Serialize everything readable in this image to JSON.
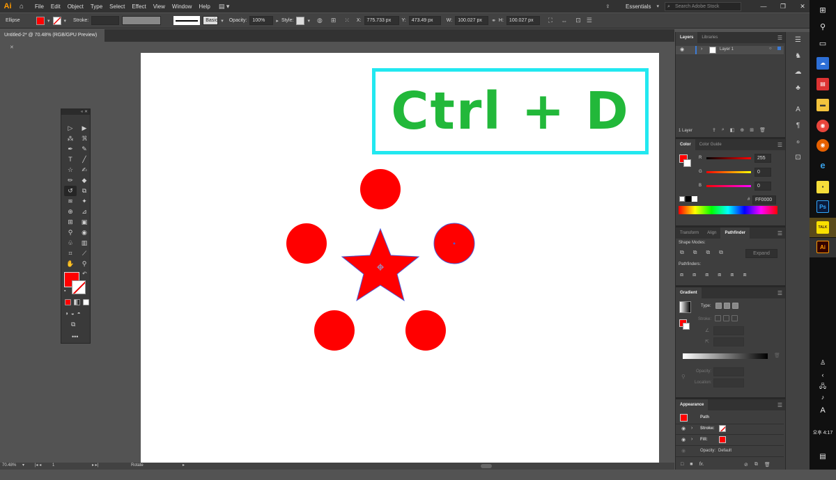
{
  "app": {
    "logo": "Ai"
  },
  "menu": [
    "File",
    "Edit",
    "Object",
    "Type",
    "Select",
    "Effect",
    "View",
    "Window",
    "Help"
  ],
  "workspace": "Essentials",
  "search_placeholder": "Search Adobe Stock",
  "control": {
    "object_type": "Ellipse",
    "stroke_label": "Stroke:",
    "brush": "Basic",
    "opacity_label": "Opacity:",
    "opacity": "100%",
    "style_label": "Style:",
    "x_label": "X:",
    "x": "775.733 px",
    "y_label": "Y:",
    "y": "473.49 px",
    "w_label": "W:",
    "w": "100.027 px",
    "h_label": "H:",
    "h": "100.027 px"
  },
  "document": {
    "tab": "Untitled-2* @ 70.48% (RGB/GPU Preview)"
  },
  "status": {
    "zoom": "70.48%",
    "artboard": "1",
    "tool": "Rotate"
  },
  "annotation": {
    "text": "Ctrl + D"
  },
  "layers": {
    "tab1": "Layers",
    "tab2": "Libraries",
    "layer_name": "Layer 1",
    "count": "1 Layer"
  },
  "color": {
    "tab1": "Color",
    "tab2": "Color Guide",
    "r_label": "R",
    "g_label": "G",
    "b_label": "B",
    "r": "255",
    "g": "0",
    "b": "0",
    "hex_label": "#",
    "hex": "FF0000",
    "fill": "#ff0000"
  },
  "pathfinder": {
    "tab1": "Transform",
    "tab2": "Align",
    "tab3": "Pathfinder",
    "shape_modes": "Shape Modes:",
    "pathfinders": "Pathfinders:",
    "expand": "Expand"
  },
  "gradient": {
    "title": "Gradient",
    "type_label": "Type:",
    "stroke_label": "Stroke:",
    "opacity_label": "Opacity:",
    "location_label": "Location:"
  },
  "appearance": {
    "title": "Appearance",
    "path": "Path",
    "stroke_label": "Stroke:",
    "fill_label": "Fill:",
    "opacity_label": "Opacity:",
    "opacity_value": "Default",
    "fx": "fx."
  },
  "taskbar": {
    "time": "오후 4:17",
    "ime": "A",
    "app_ps": "Ps",
    "app_ai": "Ai",
    "app_talk": "TALK"
  }
}
